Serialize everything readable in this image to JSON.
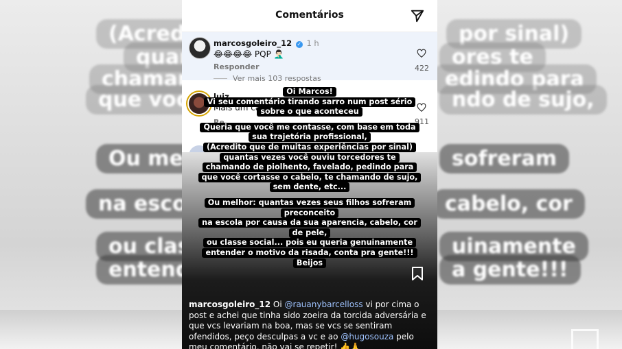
{
  "background_fragments": [
    "(Acredito",
    "por sinal)",
    "quantas",
    "ores te",
    "chamand",
    "edindo para",
    "que você c",
    "ndo de sujo,",
    "Ou melho",
    "sofreram",
    "na escola p",
    "cabelo, cor",
    "ou classe",
    "uinamente",
    "entender",
    "a gente!!!"
  ],
  "header": {
    "title": "Comentários",
    "share_icon": "paper-plane-icon"
  },
  "comments": [
    {
      "username": "marcosgoleiro_12",
      "verified": true,
      "time": "1 h",
      "text": "😂😂😂😂 PQP 🤦🏻‍♂️",
      "reply_label": "Responder",
      "likes": "422",
      "view_replies": "Ver mais 103 respostas"
    },
    {
      "username": "luiz",
      "text": "Mais um caso is",
      "reply_label": "Re",
      "likes": "911"
    }
  ],
  "story_message": [
    "Oi Marcos!",
    "Vi seu comentário tirando sarro num post sério",
    "sobre o que aconteceu",
    "",
    "Queria que você me contasse, com base em toda",
    "sua trajetória profissional,",
    "(Acredito que de muitas experiências por sinal)",
    "quantas vezes você ouviu torcedores te",
    "chamando de piolhento, favelado, pedindo para",
    "que você cortasse o cabelo, te chamando de sujo,",
    "sem dente, etc...",
    "",
    "Ou melhor: quantas vezes seus filhos sofreram",
    "preconceito",
    "na escola por causa da sua aparencia, cabelo, cor",
    "de pele,",
    "ou classe social... pois eu queria genuinamente",
    "entender o motivo da risada, conta pra gente!!!",
    "Beijos"
  ],
  "reply": {
    "username": "marcosgoleiro_12",
    "part1": " Oi ",
    "mention1": "@rauanybarcelloss",
    "part2": " vi por cima o post e achei que tinha sido zoeira da torcida adversária e que vcs levariam na boa, mas se vcs se sentiram ofendidos, peço desculpas a vc e ao ",
    "mention2": "@hugosouza",
    "part3": " pelo meu comentário, não vai se repetir! 👍🙏"
  },
  "colors": {
    "verified": "#3897f0",
    "highlight": "#eef3fb",
    "mention": "#9fc3ff"
  }
}
